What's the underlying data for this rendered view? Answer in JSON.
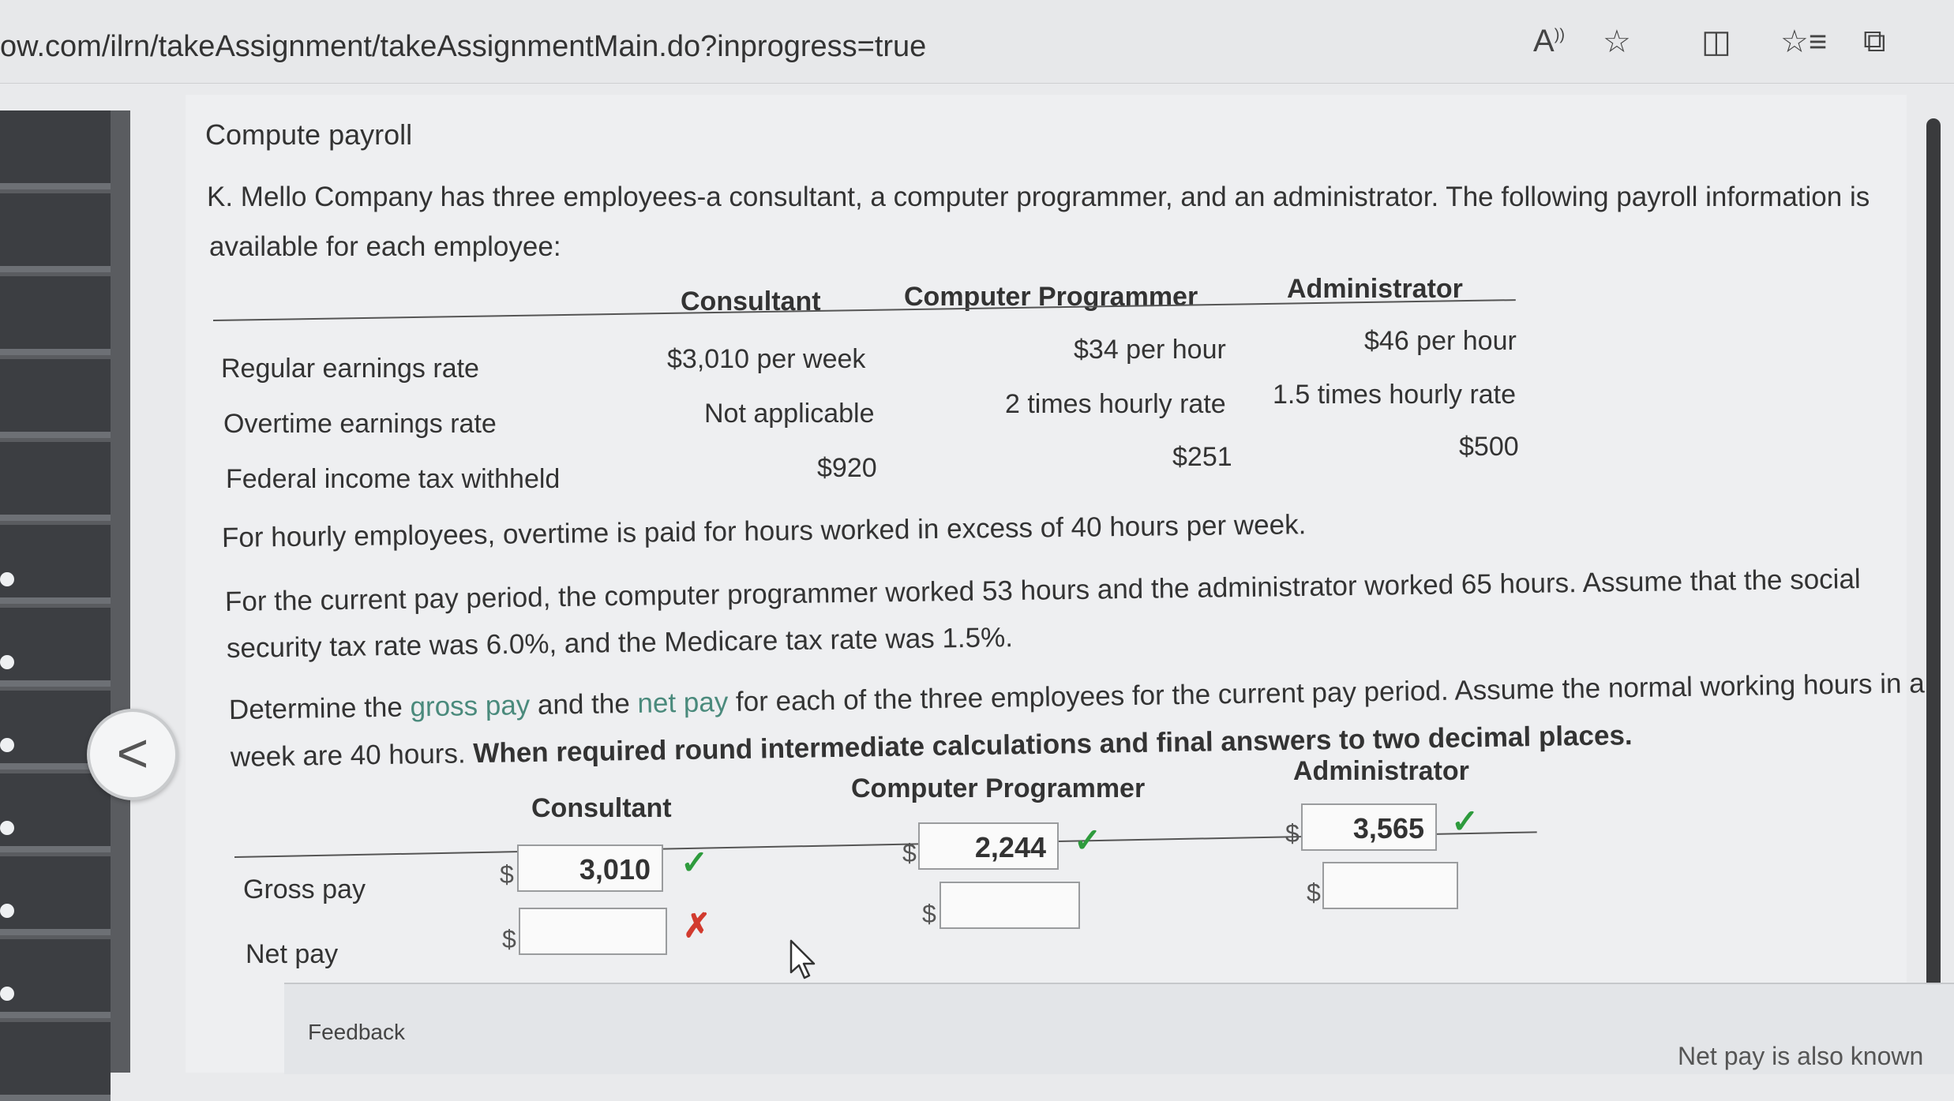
{
  "browser": {
    "url": "ow.com/ilrn/takeAssignment/takeAssignmentMain.do?inprogress=true",
    "toolbar_icons": [
      "read-aloud-icon",
      "favorite-star-icon",
      "split-screen-icon",
      "favorites-list-icon",
      "collections-icon"
    ]
  },
  "problem": {
    "title": "Compute payroll",
    "intro_line1": "K. Mello Company has three employees-a consultant, a computer programmer, and an administrator. The following payroll information is",
    "intro_line2": "available for each employee:",
    "table": {
      "headers": [
        "Consultant",
        "Computer Programmer",
        "Administrator"
      ],
      "rows": [
        {
          "label": "Regular earnings rate",
          "values": [
            "$3,010 per week",
            "$34 per hour",
            "$46 per hour"
          ]
        },
        {
          "label": "Overtime earnings rate",
          "values": [
            "Not applicable",
            "2 times hourly rate",
            "1.5 times hourly rate"
          ]
        },
        {
          "label": "Federal income tax withheld",
          "values": [
            "$920",
            "$251",
            "$500"
          ]
        }
      ]
    },
    "note1": "For hourly employees, overtime is paid for hours worked in excess of 40 hours per week.",
    "note2_line1": "For the current pay period, the computer programmer worked 53 hours and the administrator worked 65 hours. Assume that the social",
    "note2_line2": "security tax rate was 6.0%, and the Medicare tax rate was 1.5%.",
    "instr_line1_a": "Determine the ",
    "instr_line1_gross": "gross pay",
    "instr_line1_b": " and the ",
    "instr_line1_net": "net pay",
    "instr_line1_c": " for each of the three employees for the current pay period. Assume the normal working hours in a",
    "instr_line2_a": "week are 40 hours. ",
    "instr_line2_bold": "When required round intermediate calculations and final answers to two decimal places."
  },
  "answers": {
    "headers": [
      "Consultant",
      "Computer Programmer",
      "Administrator"
    ],
    "currency": "$",
    "gross_label": "Gross pay",
    "net_label": "Net pay",
    "gross": {
      "consultant": "3,010",
      "programmer": "2,244",
      "administrator": "3,565"
    },
    "net": {
      "consultant": "",
      "programmer": "",
      "administrator": ""
    },
    "status_check": "✓",
    "status_cross": "✗"
  },
  "footer": {
    "feedback": "Feedback",
    "note": "Net pay is also known"
  }
}
